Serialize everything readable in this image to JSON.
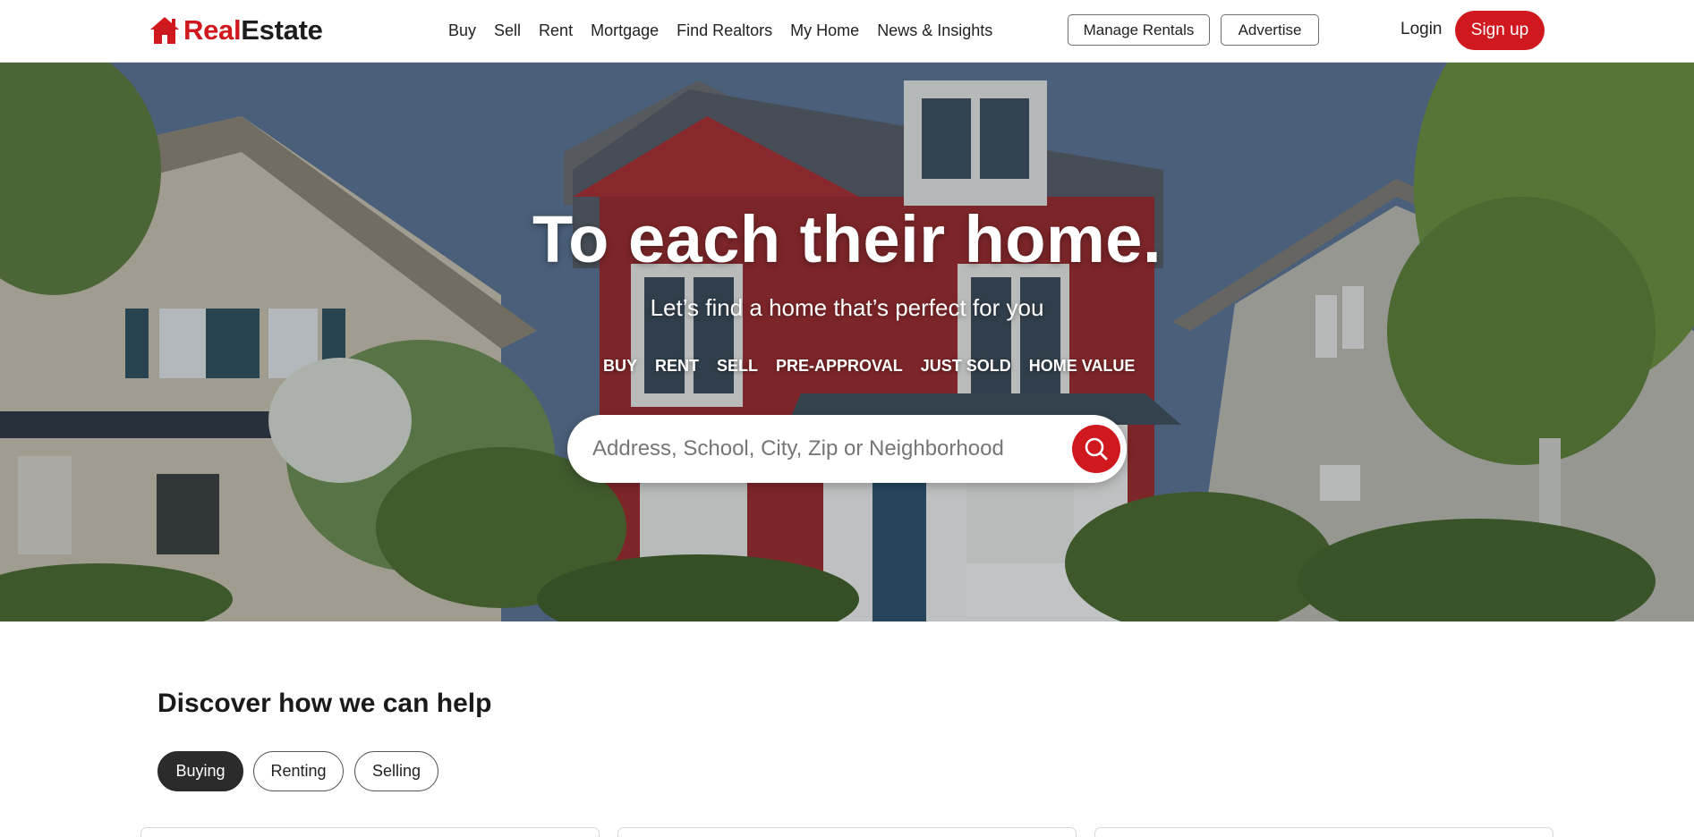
{
  "header": {
    "logo": {
      "part1": "Real",
      "part2": "Estate",
      "icon": "house-icon"
    },
    "nav": [
      "Buy",
      "Sell",
      "Rent",
      "Mortgage",
      "Find Realtors",
      "My Home",
      "News & Insights"
    ],
    "manage_rentals": "Manage Rentals",
    "advertise": "Advertise",
    "login": "Login",
    "signup": "Sign up"
  },
  "hero": {
    "title": "To each their home.",
    "subtitle": "Let’s find a home that’s perfect for you",
    "tabs": [
      "BUY",
      "RENT",
      "SELL",
      "PRE-APPROVAL",
      "JUST SOLD",
      "HOME VALUE"
    ],
    "search": {
      "placeholder": "Address, School, City, Zip or Neighborhood",
      "value": "",
      "icon": "search-icon"
    }
  },
  "discover": {
    "title": "Discover how we can help",
    "tabs": [
      "Buying",
      "Renting",
      "Selling"
    ],
    "selected_tab": "Buying"
  },
  "colors": {
    "brand_red": "#d0181f",
    "text_dark": "#222222",
    "pill_active": "#2b2b2b"
  }
}
